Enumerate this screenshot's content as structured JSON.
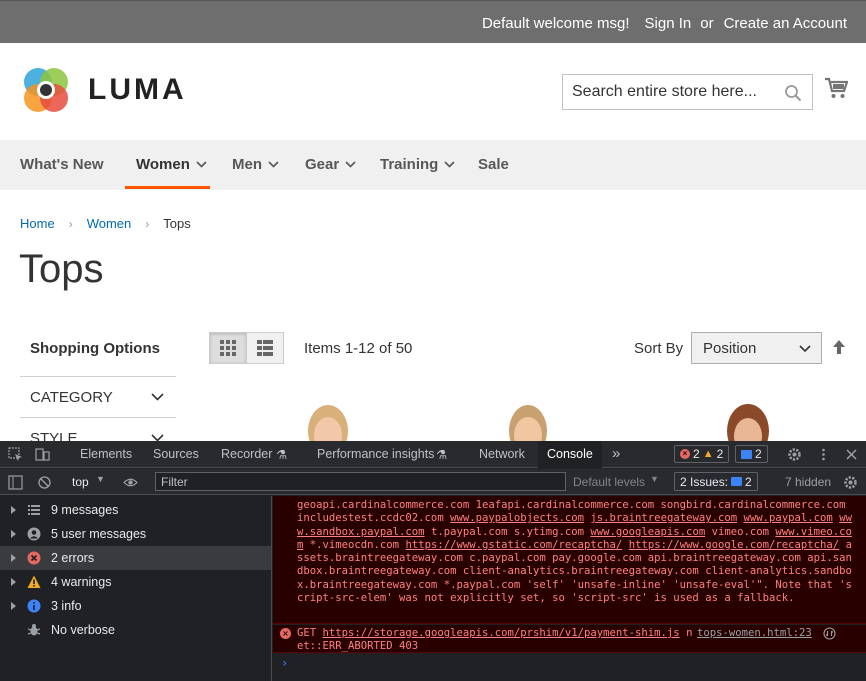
{
  "panel": {
    "welcome": "Default welcome msg!",
    "sign_in": "Sign In",
    "or": "or",
    "create_account": "Create an Account"
  },
  "header": {
    "logo_text": "LUMA",
    "search_placeholder": "Search entire store here...",
    "search_icon": "search-icon",
    "cart_icon": "cart-icon"
  },
  "nav": {
    "items": [
      {
        "label": "What's New"
      },
      {
        "label": "Women"
      },
      {
        "label": "Men"
      },
      {
        "label": "Gear"
      },
      {
        "label": "Training"
      },
      {
        "label": "Sale"
      }
    ],
    "active": "Women",
    "accent_color": "#ff5501"
  },
  "breadcrumb": {
    "home": "Home",
    "women": "Women",
    "current": "Tops"
  },
  "page_title": "Tops",
  "sidebar": {
    "title": "Shopping Options",
    "filters": [
      "CATEGORY",
      "STYLE"
    ]
  },
  "toolbar": {
    "items_count": "Items 1-12 of 50",
    "sort_label": "Sort By",
    "sort_value": "Position"
  },
  "devtools": {
    "tabs": [
      "Elements",
      "Sources",
      "Recorder",
      "Performance insights",
      "Network",
      "Console"
    ],
    "active_tab": "Console",
    "badge_errors": "2",
    "badge_warnings": "2",
    "badge_messages": "2",
    "context": "top",
    "filter_placeholder": "Filter",
    "default_levels": "Default levels",
    "issues_label": "2 Issues:",
    "issues_count": "2",
    "hidden": "7 hidden",
    "sidebar": [
      {
        "label": "9 messages",
        "icon": "list-icon"
      },
      {
        "label": "5 user messages",
        "icon": "user-icon"
      },
      {
        "label": "2 errors",
        "icon": "error-icon"
      },
      {
        "label": "4 warnings",
        "icon": "warning-icon"
      },
      {
        "label": "3 info",
        "icon": "info-icon"
      },
      {
        "label": "No verbose",
        "icon": "bug-icon"
      }
    ],
    "csp_parts": {
      "p1": "geoapi.cardinalcommerce.com 1eafapi.cardinalcommerce.com songbird.cardinalcommerce.com includestest.ccdc02.com ",
      "u1": "www.paypalobjects.com",
      "p2": " ",
      "u2": "js.braintreegateway.com",
      "p3": " ",
      "u3": "www.paypal.com",
      "p4": " ",
      "u4": "www.sandbox.paypal.com",
      "p5": " t.paypal.com s.ytimg.com ",
      "u5": "www.googleapis.com",
      "p6": " vimeo.com ",
      "u6": "www.vimeo.com",
      "p7": " *.vimeocdn.com ",
      "u7": "https://www.gstatic.com/recaptcha/",
      "p8": " ",
      "u8": "https://www.google.com/recaptcha/",
      "p9": " assets.braintreegateway.com c.paypal.com pay.google.com api.braintreegateway.com api.sandbox.braintreegateway.com client-analytics.braintreegateway.com client-analytics.sandbox.braintreegateway.com *.paypal.com 'self' 'unsafe-inline' 'unsafe-eval'\". Note that 'script-src-elem' was not explicitly set, so 'script-src' is used as a fallback."
    },
    "error_get": "GET ",
    "error_url": "https://storage.googleapis.com/prshim/v1/payment-shim.js",
    "error_tail": " net::ERR_ABORTED 403",
    "error_source": "tops-women.html:23",
    "prompt": "›"
  }
}
